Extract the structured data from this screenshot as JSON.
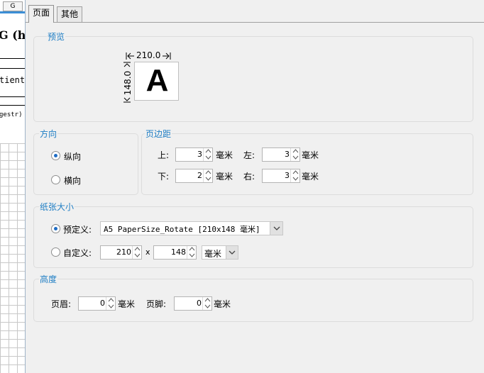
{
  "background": {
    "tab_label": "G",
    "title": "G (ho",
    "text": "tient",
    "small_text": "gestr)"
  },
  "tabs": [
    {
      "label": "页面",
      "active": true
    },
    {
      "label": "其他",
      "active": false
    }
  ],
  "preview": {
    "title": "预览",
    "width_label": "210.0",
    "height_label": "148.0",
    "letter": "A"
  },
  "orientation": {
    "title": "方向",
    "portrait": "纵向",
    "landscape": "横向",
    "selected": "portrait"
  },
  "margins": {
    "title": "页边距",
    "top_label": "上:",
    "top_value": "3",
    "left_label": "左:",
    "left_value": "3",
    "bottom_label": "下:",
    "bottom_value": "2",
    "right_label": "右:",
    "right_value": "3",
    "unit": "毫米"
  },
  "paper": {
    "title": "纸张大小",
    "preset_label": "预定义:",
    "preset_value": "A5 PaperSize_Rotate [210x148 毫米]",
    "custom_label": "自定义:",
    "custom_width": "210",
    "times": "x",
    "custom_height": "148",
    "unit_value": "毫米",
    "selected": "preset"
  },
  "height": {
    "title": "高度",
    "header_label": "页眉:",
    "header_value": "0",
    "footer_label": "页脚:",
    "footer_value": "0",
    "unit": "毫米"
  },
  "colors": {
    "accent": "#1f7ec4",
    "panel": "#f0f0f0",
    "border": "#dcdcdc"
  }
}
